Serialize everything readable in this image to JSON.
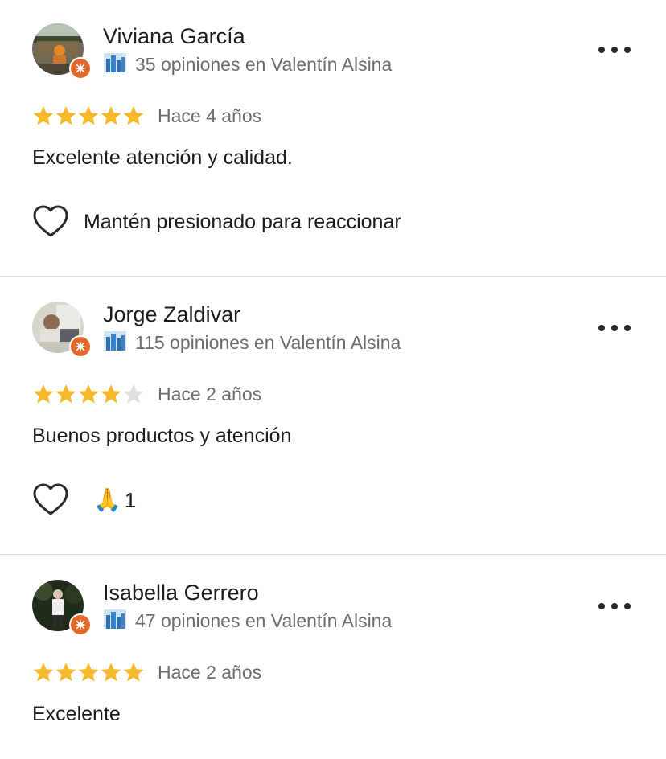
{
  "reviews": [
    {
      "name": "Viviana García",
      "meta": "35 opiniones en Valentín Alsina",
      "rating": 5,
      "time": "Hace 4 años",
      "text": "Excelente atención y calidad.",
      "reaction_label": "Mantén presionado para reaccionar",
      "reaction_emoji": "",
      "reaction_count": ""
    },
    {
      "name": "Jorge Zaldivar",
      "meta": "115 opiniones en Valentín Alsina",
      "rating": 4,
      "time": "Hace 2 años",
      "text": "Buenos productos y atención",
      "reaction_label": "",
      "reaction_emoji": "🙏",
      "reaction_count": "1"
    },
    {
      "name": "Isabella Gerrero",
      "meta": "47 opiniones en Valentín Alsina",
      "rating": 5,
      "time": "Hace 2 años",
      "text": "Excelente",
      "reaction_label": "",
      "reaction_emoji": "",
      "reaction_count": ""
    }
  ],
  "colors": {
    "star_filled": "#f6b92b",
    "star_empty": "#dedede",
    "badge": "#e3692a",
    "city_icon": "#2f6fb5"
  },
  "icons": {
    "more": "more-options-icon",
    "heart": "heart-icon",
    "badge": "local-guide-badge-icon",
    "city": "city-icon"
  }
}
